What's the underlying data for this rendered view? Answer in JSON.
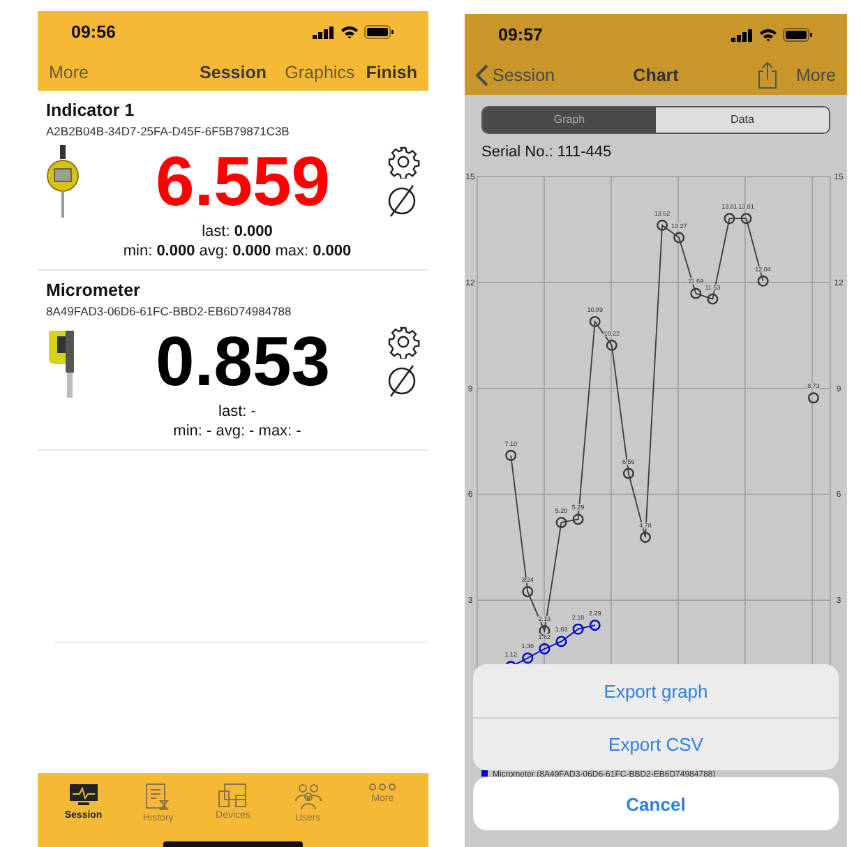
{
  "session_screen": {
    "status_time": "09:56",
    "nav": {
      "left": "More",
      "title": "Session",
      "actions": [
        "Graphics",
        "Finish"
      ]
    },
    "devices": [
      {
        "name": "Indicator 1",
        "id": "A2B2B04B-34D7-25FA-D45F-6F5B79871C3B",
        "kind": "indicator",
        "value": "6.559",
        "color": "#ff0000",
        "last": "last: **0.000**",
        "stats": "min: **0.000** avg: **0.000** max: **0.000**"
      },
      {
        "name": "Micrometer",
        "id": "8A49FAD3-06D6-61FC-BBD2-EB6D74984788",
        "kind": "micrometer",
        "value": "0.853",
        "color": "#000000",
        "last": "last: -",
        "stats": "min: - avg: - max: -"
      }
    ],
    "tabs": [
      {
        "label": "Session",
        "kind": "monitor",
        "selected": true
      },
      {
        "label": "History",
        "kind": "document",
        "selected": false
      },
      {
        "label": "Devices",
        "kind": "devices",
        "selected": false
      },
      {
        "label": "Users",
        "kind": "users",
        "selected": false
      },
      {
        "label": "More",
        "kind": "more",
        "selected": false
      }
    ]
  },
  "chart_screen": {
    "status_time": "09:57",
    "nav": {
      "back": "Session",
      "title": "Chart",
      "right": "More"
    },
    "segments": [
      {
        "label": "Graph",
        "selected": true
      },
      {
        "label": "Data",
        "selected": false
      }
    ],
    "serial": "Serial No.:  111-445",
    "chart_data": {
      "type": "line",
      "categories": [
        null,
        null,
        null,
        null,
        null,
        null,
        null,
        null,
        null,
        null,
        null,
        null,
        null,
        null,
        null,
        null,
        null,
        null,
        null,
        null,
        null,
        null
      ],
      "ylim": [
        0,
        15
      ],
      "yticks": [
        3,
        6,
        9,
        12,
        15
      ],
      "grid": true,
      "annotations": [
        "3",
        "6",
        "9",
        "12",
        "15"
      ],
      "series": [
        {
          "color": "#3a3a3a",
          "marker": "circle",
          "values": [
            null,
            null,
            7.1,
            3.24,
            2.13,
            5.2,
            5.29,
            10.89,
            10.22,
            6.59,
            4.78,
            13.62,
            13.27,
            11.69,
            11.53,
            13.81,
            13.81,
            12.04,
            null,
            null,
            null,
            null
          ],
          "value_labels": [
            null,
            null,
            "7.10",
            "3.24",
            "2.13",
            "5.20",
            "5.29",
            "10.89",
            "10.22",
            "6.59",
            "4.78",
            "13.62",
            "13.27",
            "11.69",
            "11.53",
            "13.81",
            "13.81",
            "12.04",
            null,
            null,
            null,
            null
          ]
        },
        {
          "color": "#3a3a3a",
          "marker": "circle",
          "values": [
            null,
            null,
            null,
            null,
            null,
            null,
            null,
            null,
            null,
            null,
            null,
            null,
            null,
            null,
            null,
            null,
            null,
            null,
            null,
            null,
            8.73,
            null
          ],
          "value_labels": [
            null,
            null,
            null,
            null,
            null,
            null,
            null,
            null,
            null,
            null,
            null,
            null,
            null,
            null,
            null,
            null,
            null,
            null,
            null,
            null,
            "8.73",
            null
          ]
        },
        {
          "name": "Micrometer (8A49FAD3-06D6-61FC-BBD2-EB6D74984788)",
          "color": "#0000cc",
          "marker": "circle",
          "values": [
            null,
            null,
            1.12,
            1.36,
            1.62,
            1.83,
            2.18,
            2.29,
            null,
            null,
            null,
            null,
            null,
            null,
            null,
            null,
            null,
            null,
            null,
            null,
            null,
            null
          ],
          "value_labels": [
            null,
            null,
            "1.12",
            "1.36",
            "1.62",
            "1.83",
            "2.18",
            "2.29",
            null,
            null,
            null,
            null,
            null,
            null,
            null,
            null,
            null,
            null,
            null,
            null,
            null,
            null
          ]
        }
      ]
    },
    "sheet": {
      "actions": [
        "Export graph",
        "Export CSV"
      ],
      "cancel": "Cancel"
    }
  }
}
